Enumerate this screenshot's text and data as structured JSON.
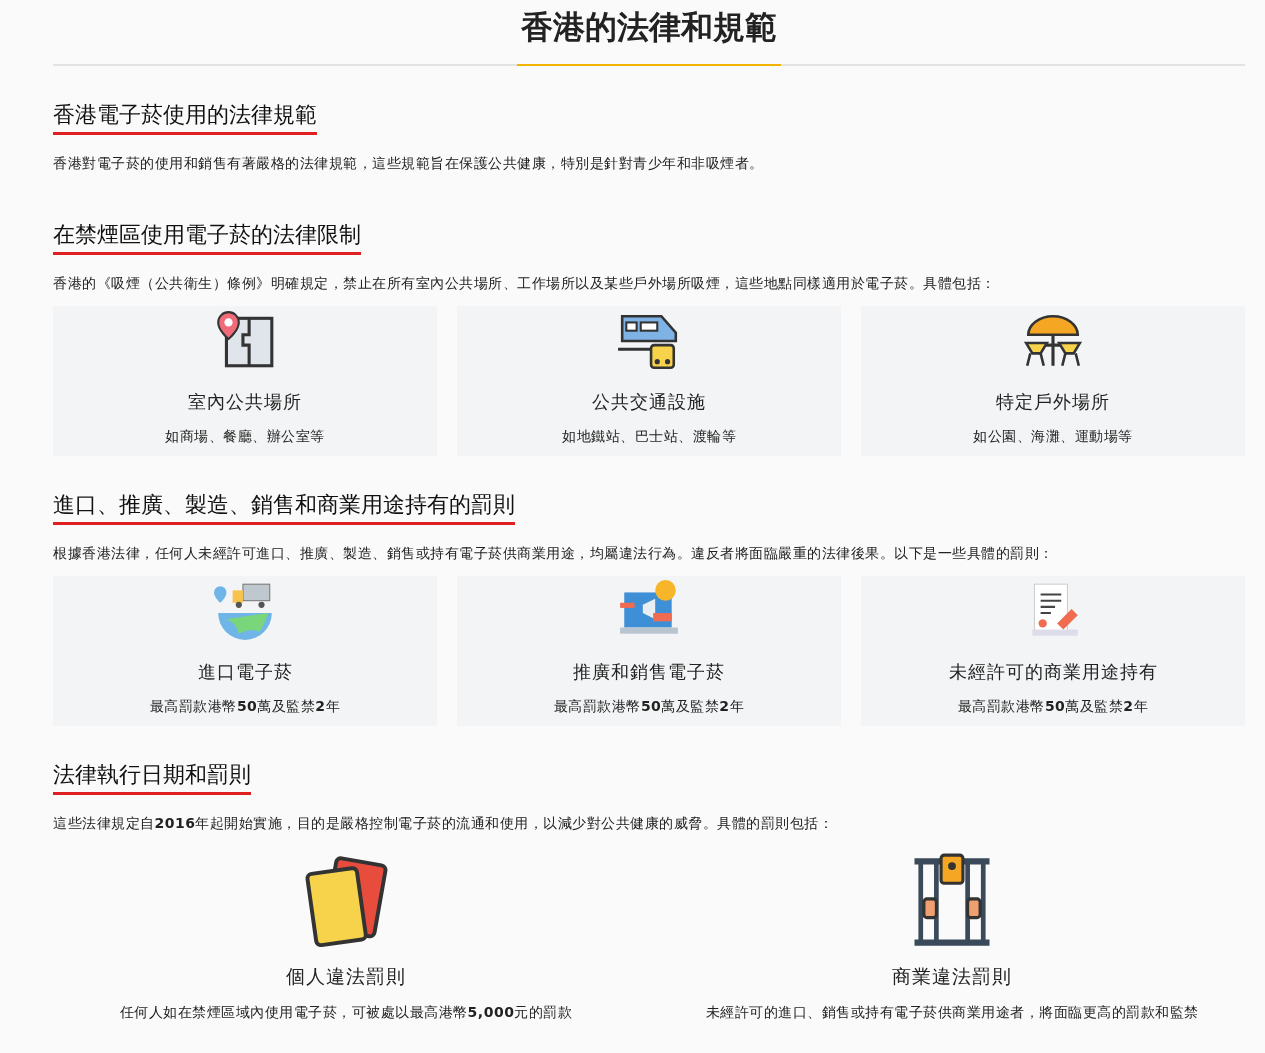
{
  "page_title": "香港的法律和規範",
  "sections": [
    {
      "heading": "香港電子菸使用的法律規範",
      "text": "香港對電子菸的使用和銷售有著嚴格的法律規範，這些規範旨在保護公共健康，特別是針對青少年和非吸煙者。"
    },
    {
      "heading": "在禁煙區使用電子菸的法律限制",
      "text": "香港的《吸煙（公共衛生）條例》明確規定，禁止在所有室內公共場所、工作場所以及某些戶外場所吸煙，這些地點同樣適用於電子菸。具體包括：",
      "kind": "cards",
      "items": [
        {
          "title": "室內公共場所",
          "detail": "如商場、餐廳、辦公室等"
        },
        {
          "title": "公共交通設施",
          "detail": "如地鐵站、巴士站、渡輪等"
        },
        {
          "title": "特定戶外場所",
          "detail": "如公園、海灘、運動場等"
        }
      ]
    },
    {
      "heading": "進口、推廣、製造、銷售和商業用途持有的罰則",
      "text": "根據香港法律，任何人未經許可進口、推廣、製造、銷售或持有電子菸供商業用途，均屬違法行為。違反者將面臨嚴重的法律後果。以下是一些具體的罰則：",
      "kind": "cards",
      "items": [
        {
          "title": "進口電子菸",
          "detail": "最高罰款港幣**50**萬及監禁**2**年"
        },
        {
          "title": "推廣和銷售電子菸",
          "detail": "最高罰款港幣**50**萬及監禁**2**年"
        },
        {
          "title": "未經許可的商業用途持有",
          "detail": "最高罰款港幣**50**萬及監禁**2**年"
        }
      ]
    },
    {
      "heading": "法律執行日期和罰則",
      "text": "這些法律規定自**2016**年起開始實施，目的是嚴格控制電子菸的流通和使用，以減少對公共健康的威脅。具體的罰則包括：",
      "kind": "plain",
      "items": [
        {
          "title": "個人違法罰則",
          "detail": "任何人如在禁煙區域內使用電子菸，可被處以最高港幣**5,000**元的罰款"
        },
        {
          "title": "商業違法罰則",
          "detail": "未經許可的進口、銷售或持有電子菸供商業用途者，將面臨更高的罰款和監禁"
        }
      ]
    }
  ]
}
